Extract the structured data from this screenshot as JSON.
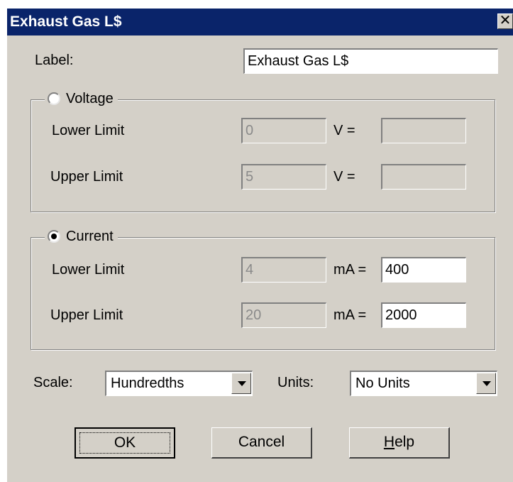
{
  "window": {
    "title": "Exhaust Gas L$",
    "close_glyph": "✕"
  },
  "label_field": {
    "label": "Label:",
    "value": "Exhaust Gas L$"
  },
  "voltage_group": {
    "title": "Voltage",
    "selected": false,
    "lower_label": "Lower Limit",
    "lower_value": "0",
    "lower_unit": "V =",
    "lower_mapped": "",
    "upper_label": "Upper Limit",
    "upper_value": "5",
    "upper_unit": "V =",
    "upper_mapped": ""
  },
  "current_group": {
    "title": "Current",
    "selected": true,
    "lower_label": "Lower Limit",
    "lower_value": "4",
    "lower_unit": "mA =",
    "lower_mapped": "400",
    "upper_label": "Upper Limit",
    "upper_value": "20",
    "upper_unit": "mA =",
    "upper_mapped": "2000"
  },
  "scale": {
    "label": "Scale:",
    "selected": "Hundredths"
  },
  "units": {
    "label": "Units:",
    "selected": "No Units"
  },
  "buttons": {
    "ok": "OK",
    "cancel": "Cancel",
    "help_first": "H",
    "help_rest": "elp"
  },
  "icons": {
    "close": "close-icon",
    "radio": "radio-icon",
    "dropdown_arrow": "chevron-down-icon"
  },
  "colors": {
    "titlebar": "#0a246a",
    "dialog_bg": "#d4d0c8"
  }
}
